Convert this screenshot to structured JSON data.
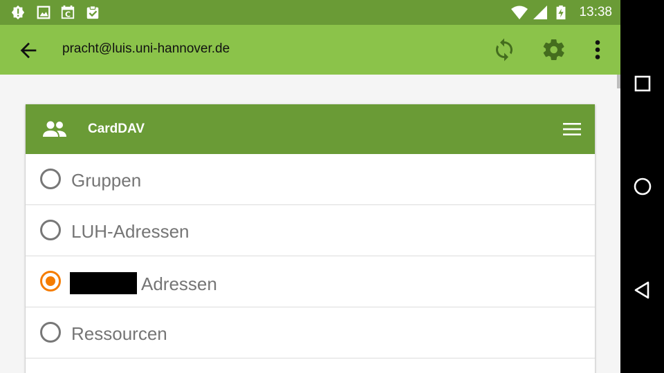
{
  "status_bar": {
    "time": "13:38",
    "icons": [
      "alert-icon",
      "image-icon",
      "calendar-sync-icon",
      "clipboard-check-icon",
      "wifi-icon",
      "signal-icon",
      "battery-charging-icon"
    ]
  },
  "toolbar": {
    "title": "pracht@luis.uni-hannover.de",
    "actions": [
      "back-arrow-icon",
      "sync-icon",
      "settings-icon",
      "more-vert-icon"
    ]
  },
  "card": {
    "title": "CardDAV",
    "items": [
      {
        "label": "Gruppen",
        "checked": false
      },
      {
        "label": "LUH-Adressen",
        "checked": false
      },
      {
        "label": "Adressen",
        "checked": true,
        "redacted_prefix": true
      },
      {
        "label": "Ressourcen",
        "checked": false
      }
    ]
  },
  "colors": {
    "status_bar": "#6a9b36",
    "toolbar": "#8bc34a",
    "card_header": "#6a9b36",
    "radio_checked": "#f57c00",
    "radio_unchecked": "#777777"
  },
  "nav_bar": [
    "recents-square-icon",
    "home-circle-icon",
    "back-triangle-icon"
  ]
}
